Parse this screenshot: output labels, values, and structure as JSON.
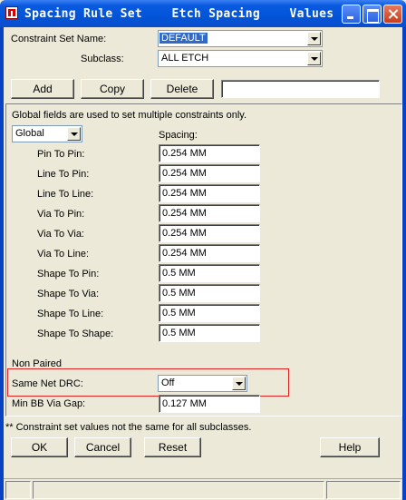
{
  "window": {
    "title": "Spacing Rule Set    Etch Spacing    Values"
  },
  "constraint_set": {
    "label": "Constraint Set Name:",
    "value": "DEFAULT"
  },
  "subclass": {
    "label": "Subclass:",
    "value": "ALL ETCH"
  },
  "buttons": {
    "add": "Add",
    "copy": "Copy",
    "delete": "Delete",
    "ok": "OK",
    "cancel": "Cancel",
    "reset": "Reset",
    "help": "Help"
  },
  "global_note": "Global fields are used to set multiple constraints only.",
  "scope_select": {
    "value": "Global"
  },
  "spacing_header": "Spacing:",
  "rules": [
    {
      "label": "Pin To Pin:",
      "value": "0.254 MM"
    },
    {
      "label": "Line To Pin:",
      "value": "0.254 MM"
    },
    {
      "label": "Line To Line:",
      "value": "0.254 MM"
    },
    {
      "label": "Via To Pin:",
      "value": "0.254 MM"
    },
    {
      "label": "Via To Via:",
      "value": "0.254 MM"
    },
    {
      "label": "Via To Line:",
      "value": "0.254 MM"
    },
    {
      "label": "Shape To Pin:",
      "value": "0.5 MM"
    },
    {
      "label": "Shape To Via:",
      "value": "0.5 MM"
    },
    {
      "label": "Shape To Line:",
      "value": "0.5 MM"
    },
    {
      "label": "Shape To Shape:",
      "value": "0.5 MM"
    }
  ],
  "non_paired": {
    "heading": "Non Paired",
    "same_net_drc_label": "Same Net DRC:",
    "same_net_drc_value": "Off",
    "min_bb_via_gap_label": "Min BB Via Gap:",
    "min_bb_via_gap_value": "0.127 MM"
  },
  "footnote": "** Constraint set values not the same for all subclasses.",
  "colors": {
    "title_bar": "#0a5ae0",
    "highlight": "#316ac5",
    "red_outline": "#dd2222"
  }
}
